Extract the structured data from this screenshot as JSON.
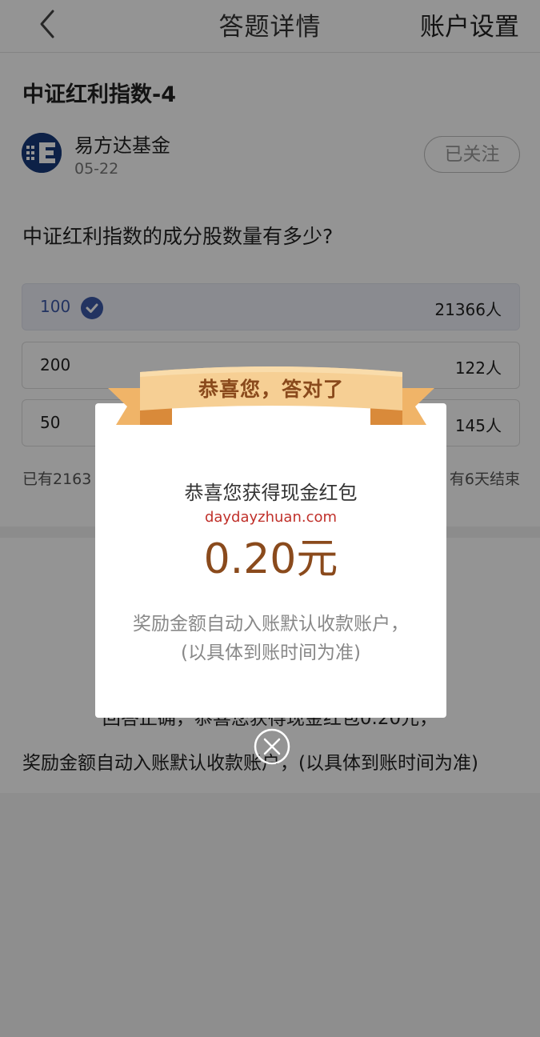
{
  "nav": {
    "title": "答题详情",
    "right_label": "账户设置",
    "back_icon": "chevron-left-icon"
  },
  "article": {
    "title": "中证红利指数-4",
    "author": "易方达基金",
    "date": "05-22",
    "follow_label": "已关注",
    "question": "中证红利指数的成分股数量有多少?",
    "options": [
      {
        "label": "100",
        "count": "21366人",
        "selected": true
      },
      {
        "label": "200",
        "count": "122人",
        "selected": false
      },
      {
        "label": "50",
        "count": "145人",
        "selected": false
      }
    ],
    "stats_left": "已有2163",
    "stats_right": "有6天结束"
  },
  "answer": {
    "line1": "回答正确，恭喜您获得现金红包0.20元，",
    "line2": "奖励金额自动入账默认收款账户，(以具体到账时间为准)"
  },
  "modal": {
    "ribbon_text": "恭喜您，答对了",
    "heading": "恭喜您获得现金红包",
    "watermark": "daydayzhuan.com",
    "amount": "0.20元",
    "note_line1": "奖励金额自动入账默认收款账户，",
    "note_line2": "(以具体到账时间为准)",
    "close_icon": "close-circle-icon"
  },
  "colors": {
    "accent_blue": "#3c58a8",
    "ribbon_gold": "#f3c685",
    "amount_brown": "#8a4a1c",
    "watermark_red": "#c0302a"
  }
}
